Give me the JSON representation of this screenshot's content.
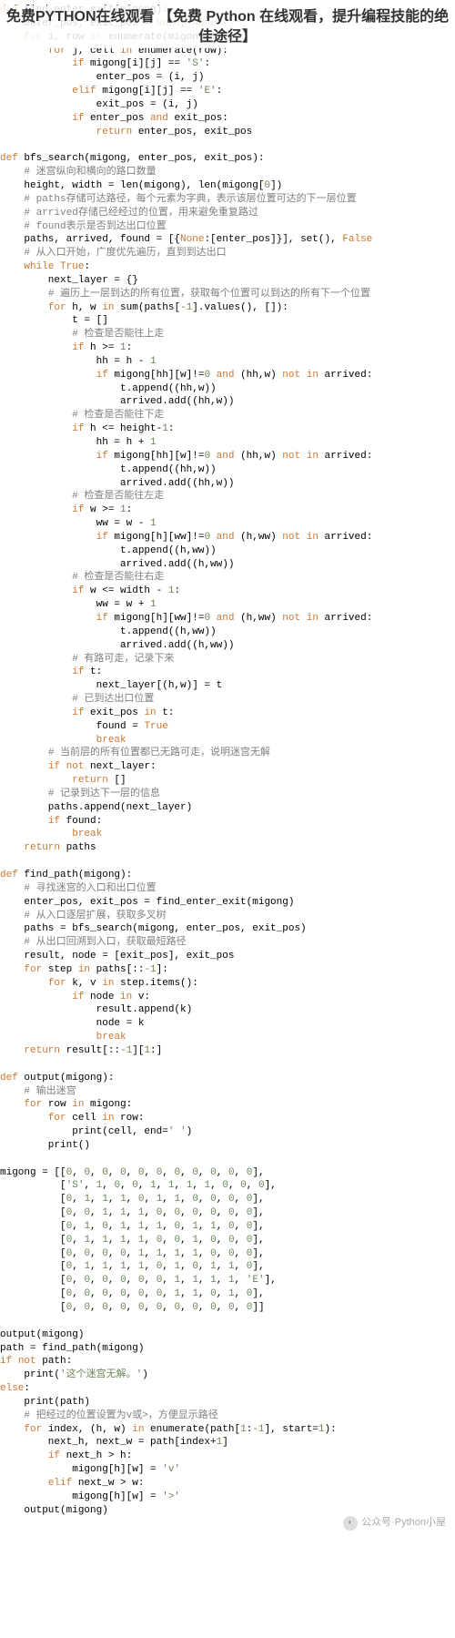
{
  "header": "免费PYTHON在线观看 【免费 Python 在线观看，提升编程技能的绝佳途径】",
  "watermark": "公众号·Python小屋",
  "code": {
    "fn1": {
      "def": "def",
      "name": "find_enter_exit",
      "sig": "(migong):",
      "l1": "enter_pos, exit_pos = ",
      "none": "None",
      "for1": "for",
      "in": "in",
      "enum": "enumerate",
      "i": "i",
      "row": "row",
      "m": "migong",
      "j": "j",
      "cell": "cell",
      "if": "if",
      "S": "'S'",
      "E": "'E'",
      "and": "and",
      "ret": "return",
      "eq": "==",
      "elif": "elif"
    },
    "fn2": {
      "name": "bfs_search",
      "sig": "(migong, enter_pos, exit_pos):",
      "c1": "# 迷宫纵向和横向的路口数量",
      "l1": "height, width = len(migong), len(migong[",
      "z": "0",
      "c2": "# paths存储可达路径，每个元素为字典，表示该层位置可达的下一层位置",
      "c3": "# arrived存储已经经过的位置，用来避免重复路过",
      "c4": "# found表示是否到达出口位置",
      "l2": "paths, arrived, found = [{",
      "none": "None",
      ":[enter_pos]}], set(), ": "]:[enter_pos]}], set(), ",
      "false": "False",
      "c5": "# 从入口开始，广度优先遍历，直到到达出口",
      "while": "while",
      "true": "True",
      "nl": "next_layer = {}",
      "c6": "# 遍历上一层到达的所有位置，获取每个位置可以到达的所有下一个位置",
      "for": "for",
      "hw": " h, w ",
      "in": "in",
      "sum": " sum(paths[",
      "m1": "-1",
      "vals": "].values(), []):",
      "t": "t = []",
      "cu": "# 检查是否能往上走",
      "if": "if",
      "hge": " h >= ",
      "one": "1",
      "hh": "hh = h - ",
      "mh": "migong[hh][w]!=",
      "and": "and",
      "notin": " (hh,w) ",
      "not": "not",
      "arr": " arrived:",
      "app": "t.append((hh,w))",
      "add": "arrived.add((hh,w))",
      "cd": "# 检查是否能往下走",
      "hle": " h <= height-",
      "hh2": "hh = h + ",
      "cl": "# 检查是否能往左走",
      "wge": " w >= ",
      "ww": "ww = w - ",
      "mw": "migong[h][ww]!=",
      "hww": "(h,ww)",
      "appw": "t.append((h,ww))",
      "addw": "arrived.add((h,ww))",
      "cr": "# 检查是否能往右走",
      "wle": " w <= width - ",
      "ww2": "ww = w + ",
      "cp": "# 有路可走，记录下来",
      "tt": " t:",
      "nlhw": "next_layer[(h,w)] = t",
      "ce": "# 已到达出口位置",
      "ep": " exit_pos ",
      "int": " t:",
      "fnd": "found = ",
      "break": "break",
      "cn": "# 当前层的所有位置都已无路可走，说明迷宫无解",
      "nnl": " next_layer:",
      "retempty": "return []",
      "cr2": "# 记录到达下一层的信息",
      "pa": "paths.append(next_layer)",
      "iff": " found:",
      "retp": "return paths"
    },
    "fn3": {
      "name": "find_path",
      "sig": "(migong):",
      "c1": "# 寻找迷宫的入口和出口位置",
      "l1": "enter_pos, exit_pos = find_enter_exit(migong)",
      "c2": "# 从入口逐层扩展，获取多叉树",
      "l2": "paths = bfs_search(migong, enter_pos, exit_pos)",
      "c3": "# 从出口回溯到入口，获取最短路径",
      "l3": "result, node = [exit_pos], exit_pos",
      "for": "for",
      "step": " step ",
      "in": "in",
      "ps": " paths[::",
      "m1": "-1",
      "kv": " k, v ",
      "si": " step.items():",
      "if": "if",
      "nv": " node ",
      "v": " v:",
      "ra": "result.append(k)",
      "nk": "node = k",
      "break": "break",
      "ret": "return",
      "rr": " result[::",
      "sl": "][",
      "one": "1",
      ":]": "]:"
    },
    "fn4": {
      "name": "output",
      "sig": "(migong):",
      "c1": "# 输出迷宫",
      "for": "for",
      "row": " row ",
      "in": "in",
      "m": " migong:",
      "cell": " cell ",
      "r": " row:",
      "p": "print",
      "ce": "(cell, end=",
      "sp": "' '",
      "pp": "print()"
    },
    "data": {
      "m": "migong = [[",
      "rows": [
        "0, 0, 0, 0, 0, 0, 0, 0, 0, 0, 0],",
        "'S', 1, 0, 0, 1, 1, 1, 1, 0, 0, 0],",
        "0, 1, 1, 1, 0, 1, 1, 0, 0, 0, 0],",
        "0, 0, 1, 1, 1, 0, 0, 0, 0, 0, 0],",
        "0, 1, 0, 1, 1, 1, 0, 1, 1, 0, 0],",
        "0, 1, 1, 1, 1, 0, 0, 1, 0, 0, 0],",
        "0, 0, 0, 0, 1, 1, 1, 1, 0, 0, 0],",
        "0, 1, 1, 1, 1, 0, 1, 0, 1, 1, 0],",
        "0, 0, 0, 0, 0, 0, 1, 1, 1, 1, 'E'],",
        "0, 0, 0, 0, 0, 0, 1, 1, 0, 1, 0],",
        "0, 0, 0, 0, 0, 0, 0, 0, 0, 0, 0]]"
      ]
    },
    "run": {
      "o1": "output(migong)",
      "p1": "path = find_path(migong)",
      "if": "if",
      "not": "not",
      "path": " path:",
      "pr": "print",
      "msg": "'这个迷宫无解。'",
      "else": "else",
      "pp": "print(path)",
      "c1": "# 把经过的位置设置为v或>，方便显示路径",
      "for": "for",
      "idx": " index, (h, w) ",
      "in": "in",
      "enum": " enumerate(path[",
      "one": "1",
      "m1": "-1",
      "st": "], start=",
      "nh": "next_h, next_w = path[index+",
      "ifh": " next_h > h:",
      "mv": "migong[h][w] = ",
      "v": "'v'",
      "elif": "elif",
      "ifw": " next_w > w:",
      "gt": "'>'",
      "out": "output(migong)"
    }
  }
}
